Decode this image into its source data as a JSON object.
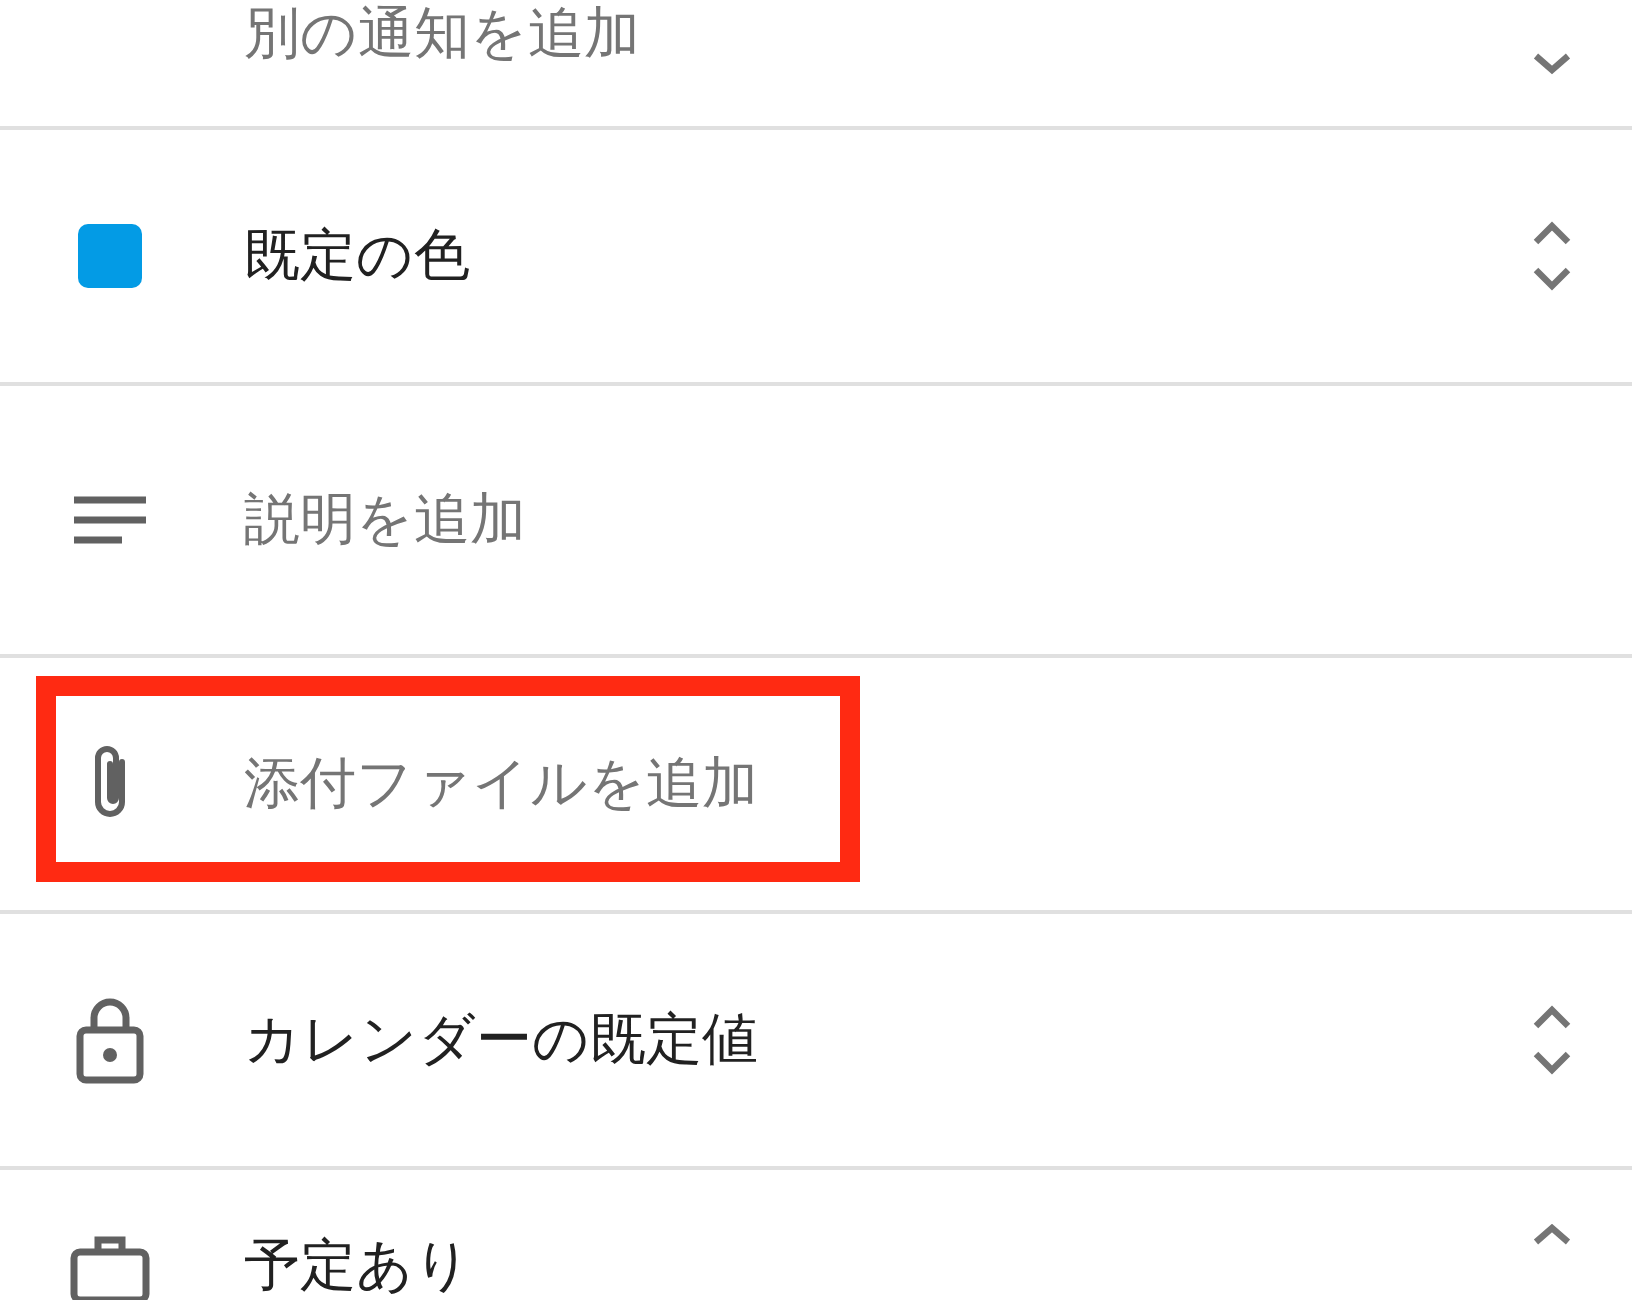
{
  "rows": [
    {
      "kind": "notification",
      "label": "別の通知を追加",
      "muted": true,
      "highlighted": false
    },
    {
      "kind": "color",
      "color": "#039be5",
      "label": "既定の色",
      "muted": false,
      "highlighted": false
    },
    {
      "kind": "description",
      "label": "説明を追加",
      "muted": true,
      "highlighted": false
    },
    {
      "kind": "attachment",
      "label": "添付ファイルを追加",
      "muted": true,
      "highlighted": true
    },
    {
      "kind": "calendar",
      "label": "カレンダーの既定値",
      "muted": false,
      "highlighted": false
    },
    {
      "kind": "availability",
      "label": "予定あり",
      "muted": false,
      "highlighted": false
    }
  ]
}
